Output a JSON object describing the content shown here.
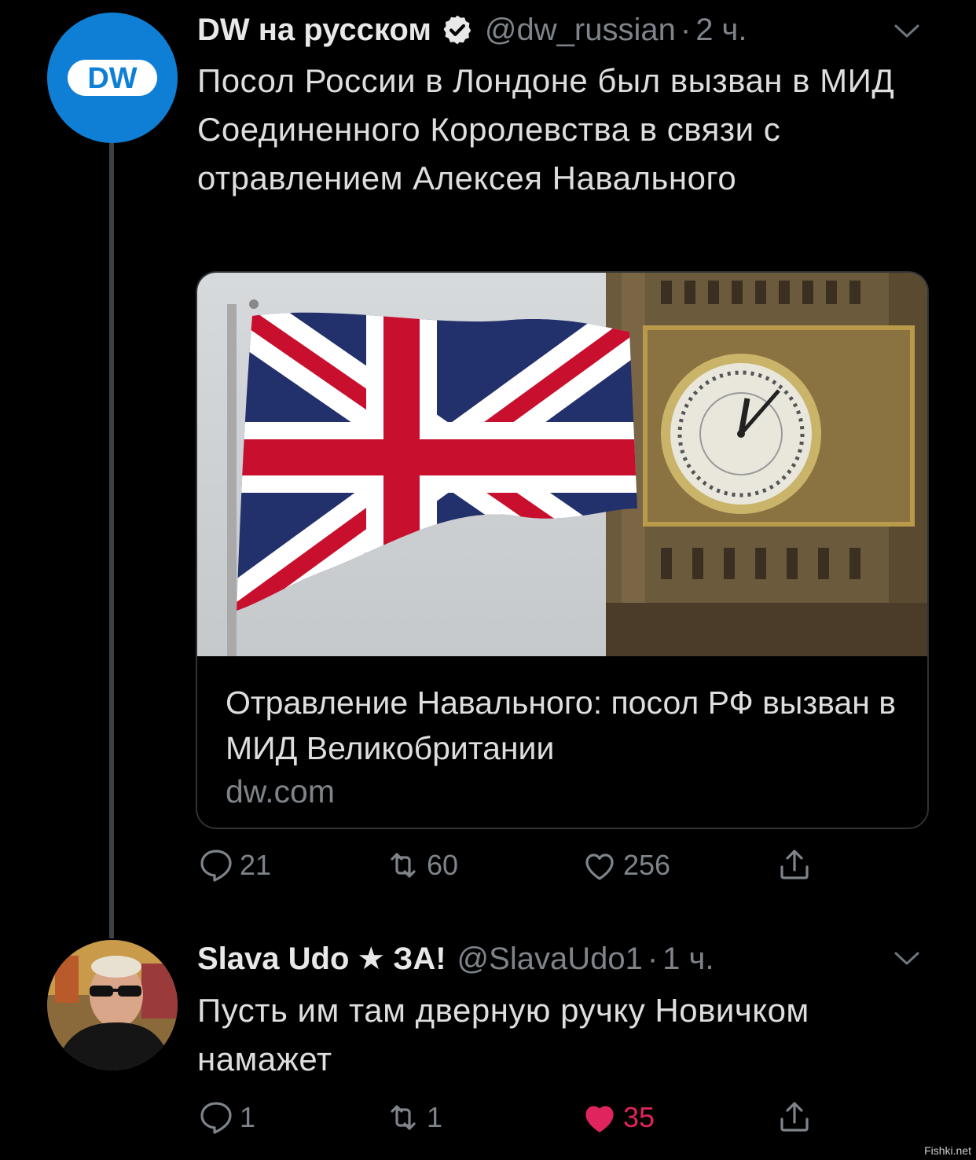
{
  "tweets": [
    {
      "name": "DW на русском",
      "handle": "@dw_russian",
      "separator": "·",
      "time": "2 ч.",
      "text": "Посол России в Лондоне был вызван в МИД Соединенного Королевства в связи с отравлением Алексея Навального",
      "avatar_text": "DW",
      "card": {
        "title": "Отравление Навального: посол РФ вызван в МИД Великобритании",
        "domain": "dw.com"
      },
      "actions": {
        "replies": "21",
        "retweets": "60",
        "likes": "256"
      },
      "liked": false
    },
    {
      "name": "Slava Udo",
      "name_suffix": "ЗА!",
      "handle": "@SlavaUdo1",
      "separator": "·",
      "time": "1 ч.",
      "text": "Пусть им там дверную ручку Новичком намажет",
      "actions": {
        "replies": "1",
        "retweets": "1",
        "likes": "35"
      },
      "liked": true
    }
  ],
  "icons": [
    "verified-icon",
    "chevron-down-icon",
    "star-icon",
    "reply-icon",
    "retweet-icon",
    "like-icon",
    "share-icon"
  ],
  "colors": {
    "background": "#000000",
    "text": "#dedede",
    "muted": "#7e848a",
    "like": "#e0245e",
    "dw_blue": "#0f7fd6"
  },
  "watermark": "Fishki.net"
}
